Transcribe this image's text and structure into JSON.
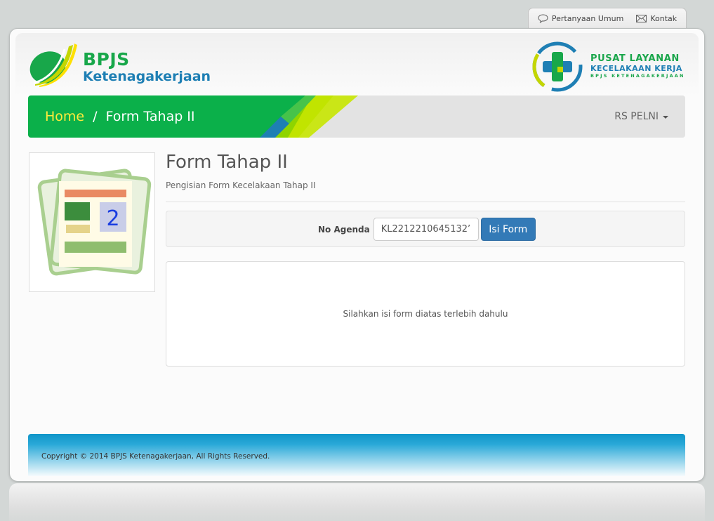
{
  "toplinks": {
    "faq_label": "Pertanyaan Umum",
    "contact_label": "Kontak"
  },
  "header": {
    "brand_line1": "BPJS",
    "brand_line2": "Ketenagakerjaan",
    "service_line1": "PUSAT LAYANAN",
    "service_line2": "KECELAKAAN KERJA",
    "service_line3": "BPJS KETENAGAKERJAAN"
  },
  "breadcrumb": {
    "home": "Home",
    "separator": "/",
    "current": "Form Tahap II"
  },
  "user_menu": {
    "label": "RS PELNI"
  },
  "page": {
    "title": "Form Tahap II",
    "subtitle": "Pengisian Form Kecelakaan Tahap II",
    "thumbnail_number": "2"
  },
  "form": {
    "label": "No Agenda",
    "value": "KL2212210645132’",
    "button_label": "Isi Form"
  },
  "result": {
    "message": "Silahkan isi form diatas terlebih dahulu"
  },
  "footer": {
    "copyright": "Copyright © 2014 BPJS Ketenagakerjaan, All Rights Reserved."
  },
  "colors": {
    "brand_green": "#0bb04a",
    "brand_blue": "#1e7fb4",
    "home_yellow": "#ffeb3b",
    "button_blue": "#337ab7",
    "footer_blue": "#0f95c8"
  }
}
